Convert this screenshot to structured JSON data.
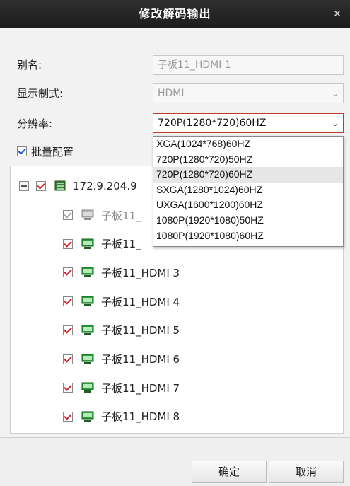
{
  "dialog": {
    "title": "修改解码输出",
    "close_icon": "close-icon"
  },
  "form": {
    "alias_label": "别名:",
    "alias_value": "子板11_HDMI 1",
    "display_label": "显示制式:",
    "display_value": "HDMI",
    "resolution_label": "分辨率:",
    "resolution_value": "720P(1280*720)60HZ",
    "batch_label": "批量配置",
    "batch_checked": true
  },
  "resolution_options": [
    "XGA(1024*768)60HZ",
    "720P(1280*720)50HZ",
    "720P(1280*720)60HZ",
    "SXGA(1280*1024)60HZ",
    "UXGA(1600*1200)60HZ",
    "1080P(1920*1080)50HZ",
    "1080P(1920*1080)60HZ"
  ],
  "selected_option_index": 2,
  "tree": {
    "root_label": "172.9.204.9",
    "items": [
      {
        "label": "子板11_",
        "disabled": true
      },
      {
        "label": "子板11_",
        "disabled": false
      },
      {
        "label": "子板11_HDMI 3",
        "disabled": false
      },
      {
        "label": "子板11_HDMI 4",
        "disabled": false
      },
      {
        "label": "子板11_HDMI 5",
        "disabled": false
      },
      {
        "label": "子板11_HDMI 6",
        "disabled": false
      },
      {
        "label": "子板11_HDMI 7",
        "disabled": false
      },
      {
        "label": "子板11_HDMI 8",
        "disabled": false
      }
    ]
  },
  "buttons": {
    "ok": "确定",
    "cancel": "取消"
  },
  "colors": {
    "titlebar": "#232323",
    "accent_red": "#d01f26",
    "device_green": "#2e9b3a"
  }
}
